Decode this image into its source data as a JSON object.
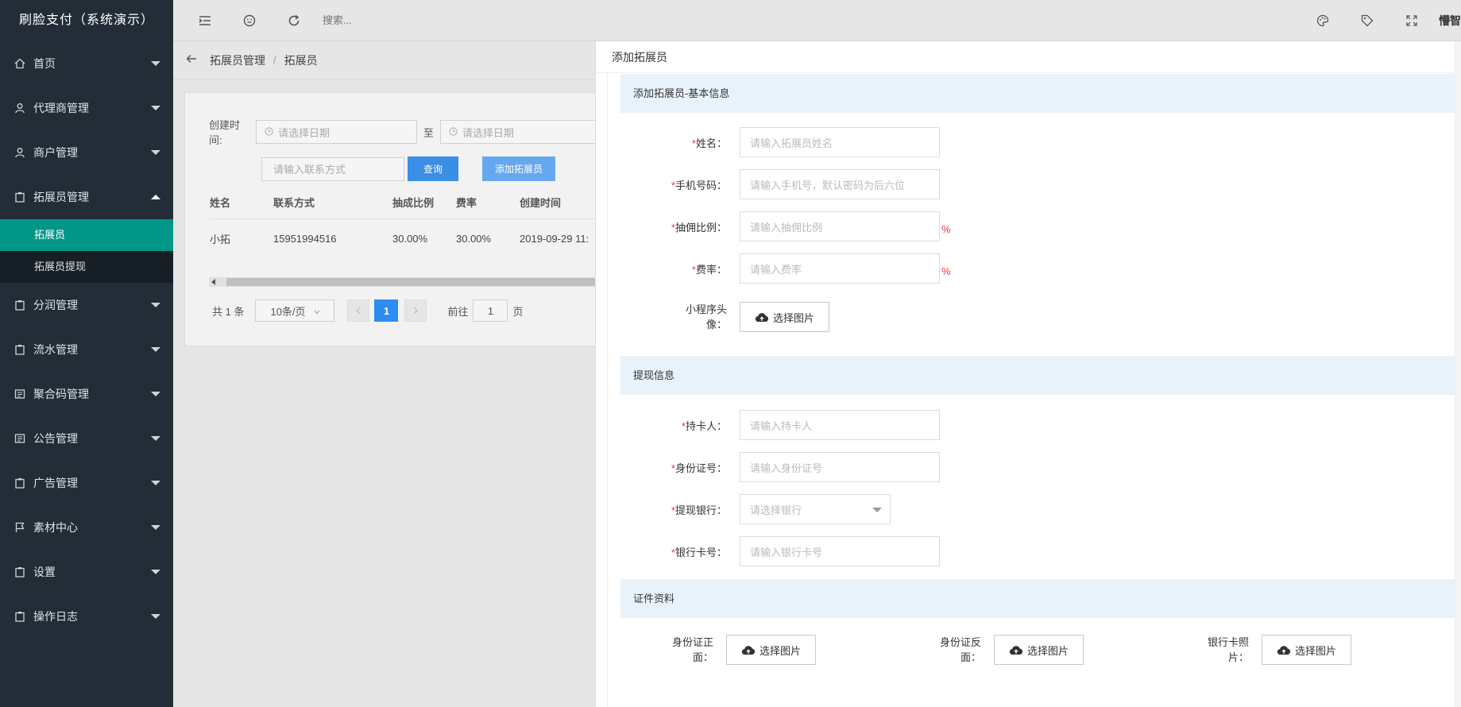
{
  "app": {
    "title": "刷脸支付（系统演示）"
  },
  "sidebar": {
    "items": [
      {
        "label": "首页",
        "icon": "home-icon"
      },
      {
        "label": "代理商管理",
        "icon": "user-icon"
      },
      {
        "label": "商户管理",
        "icon": "user-icon"
      },
      {
        "label": "拓展员管理",
        "icon": "clipboard-icon",
        "expanded": true,
        "children": [
          {
            "label": "拓展员",
            "active": true
          },
          {
            "label": "拓展员提现"
          }
        ]
      },
      {
        "label": "分润管理",
        "icon": "clipboard-icon"
      },
      {
        "label": "流水管理",
        "icon": "clipboard-icon"
      },
      {
        "label": "聚合码管理",
        "icon": "list-icon"
      },
      {
        "label": "公告管理",
        "icon": "list-icon"
      },
      {
        "label": "广告管理",
        "icon": "clipboard-icon"
      },
      {
        "label": "素材中心",
        "icon": "flag-icon"
      },
      {
        "label": "设置",
        "icon": "clipboard-icon"
      },
      {
        "label": "操作日志",
        "icon": "clipboard-icon"
      }
    ],
    "active_color": "#009688"
  },
  "topbar": {
    "search_placeholder": "搜索...",
    "user": "懵智"
  },
  "breadcrumb": {
    "items": [
      "拓展员管理",
      "拓展员"
    ],
    "separator": "/"
  },
  "filters": {
    "created_label": "创建时间:",
    "date_start_placeholder": "请选择日期",
    "to_label": "至",
    "date_end_placeholder": "请选择日期",
    "contact_placeholder": "请输入联系方式",
    "query_button": "查询",
    "add_button": "添加拓展员"
  },
  "table": {
    "columns": [
      "姓名",
      "联系方式",
      "抽成比例",
      "费率",
      "创建时间"
    ],
    "rows": [
      [
        "小拓",
        "15951994516",
        "30.00%",
        "30.00%",
        "2019-09-29 11:"
      ]
    ]
  },
  "pager": {
    "total": "共 1 条",
    "page_size": "10条/页",
    "current_page": "1",
    "goto_label": "前往",
    "goto_value": "1",
    "page_suffix": "页"
  },
  "drawer": {
    "title": "添加拓展员",
    "sections": {
      "basic": "添加拓展员-基本信息",
      "withdraw": "提现信息",
      "docs": "证件资料"
    },
    "fields": {
      "name": {
        "label": "姓名：",
        "placeholder": "请输入拓展员姓名"
      },
      "phone": {
        "label": "手机号码：",
        "placeholder": "请输入手机号，默认密码为后六位"
      },
      "commission": {
        "label": "抽佣比例：",
        "placeholder": "请输入抽佣比例",
        "unit": "%"
      },
      "rate": {
        "label": "费率：",
        "placeholder": "请输入费率",
        "unit": "%"
      },
      "avatar": {
        "label_line1": "小程序头",
        "label_line2": "像：",
        "button": "选择图片"
      },
      "holder": {
        "label": "持卡人：",
        "placeholder": "请输入持卡人"
      },
      "id_no": {
        "label": "身份证号：",
        "placeholder": "请输入身份证号"
      },
      "bank": {
        "label": "提现银行：",
        "placeholder": "请选择银行"
      },
      "card_no": {
        "label": "银行卡号：",
        "placeholder": "请输入银行卡号"
      },
      "id_front": {
        "label_line1": "身份证正",
        "label_line2": "面：",
        "button": "选择图片"
      },
      "id_back": {
        "label_line1": "身份证反",
        "label_line2": "面：",
        "button": "选择图片"
      },
      "card_photo": {
        "label_line1": "银行卡照",
        "label_line2": "片：",
        "button": "选择图片"
      }
    },
    "required_mark": "*",
    "section_bg": "#e8f2fb"
  }
}
